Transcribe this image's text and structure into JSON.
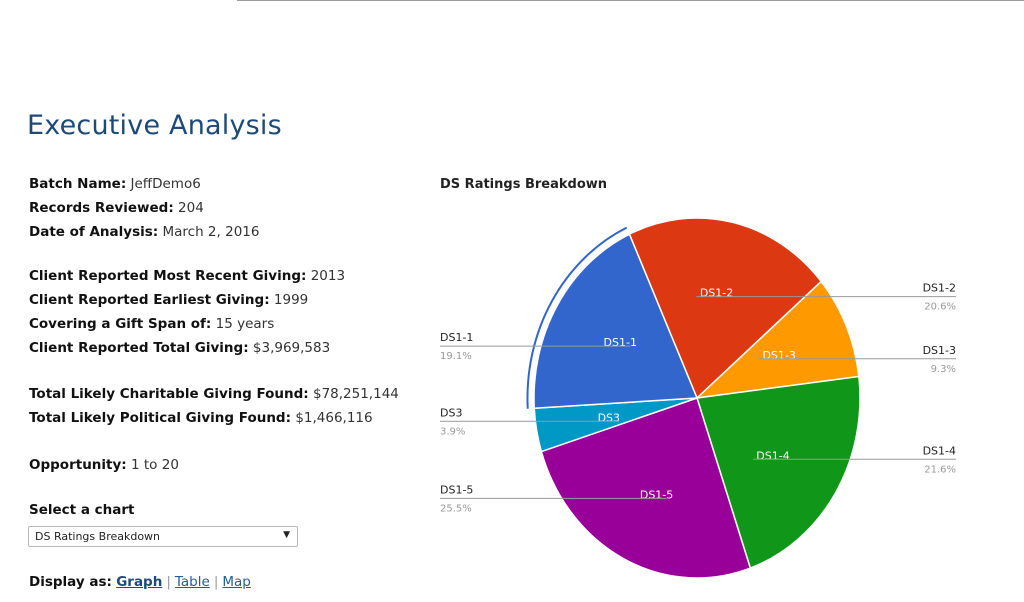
{
  "page": {
    "title": "Executive Analysis"
  },
  "summary": {
    "batch_name": {
      "label": "Batch Name",
      "value": "JeffDemo6"
    },
    "records_reviewed": {
      "label": "Records Reviewed",
      "value": "204"
    },
    "date_of_analysis": {
      "label": "Date of Analysis",
      "value": "March 2, 2016"
    },
    "most_recent_giving": {
      "label": "Client Reported Most Recent Giving",
      "value": "2013"
    },
    "earliest_giving": {
      "label": "Client Reported Earliest Giving",
      "value": "1999"
    },
    "gift_span": {
      "label": "Covering a Gift Span of",
      "value": "15 years"
    },
    "total_giving": {
      "label": "Client Reported Total Giving",
      "value": "$3,969,583"
    },
    "charitable_found": {
      "label": "Total Likely Charitable Giving Found",
      "value": "$78,251,144"
    },
    "political_found": {
      "label": "Total Likely Political Giving Found",
      "value": "$1,466,116"
    },
    "opportunity": {
      "label": "Opportunity",
      "value": "1 to 20"
    }
  },
  "chart_selector": {
    "label": "Select a chart",
    "selected": "DS Ratings Breakdown",
    "arrow": "▼"
  },
  "display_as": {
    "label": "Display as",
    "options": [
      "Graph",
      "Table",
      "Map"
    ],
    "active": "Graph"
  },
  "chart_data": {
    "type": "pie",
    "title": "DS Ratings Breakdown",
    "categories": [
      "DS1-2",
      "DS1-3",
      "DS1-4",
      "DS1-5",
      "DS3",
      "DS1-1"
    ],
    "values": [
      20.6,
      9.3,
      21.6,
      25.5,
      3.9,
      19.1
    ],
    "value_labels": [
      "20.6%",
      "9.3%",
      "21.6%",
      "25.5%",
      "3.9%",
      "19.1%"
    ],
    "colors": [
      "#dc3912",
      "#ff9900",
      "#109618",
      "#990099",
      "#0099c6",
      "#3366cc"
    ],
    "label_sides": [
      "right",
      "right",
      "right",
      "left",
      "left",
      "left"
    ],
    "highlighted": "DS1-1",
    "legend": "labeled leader lines"
  }
}
